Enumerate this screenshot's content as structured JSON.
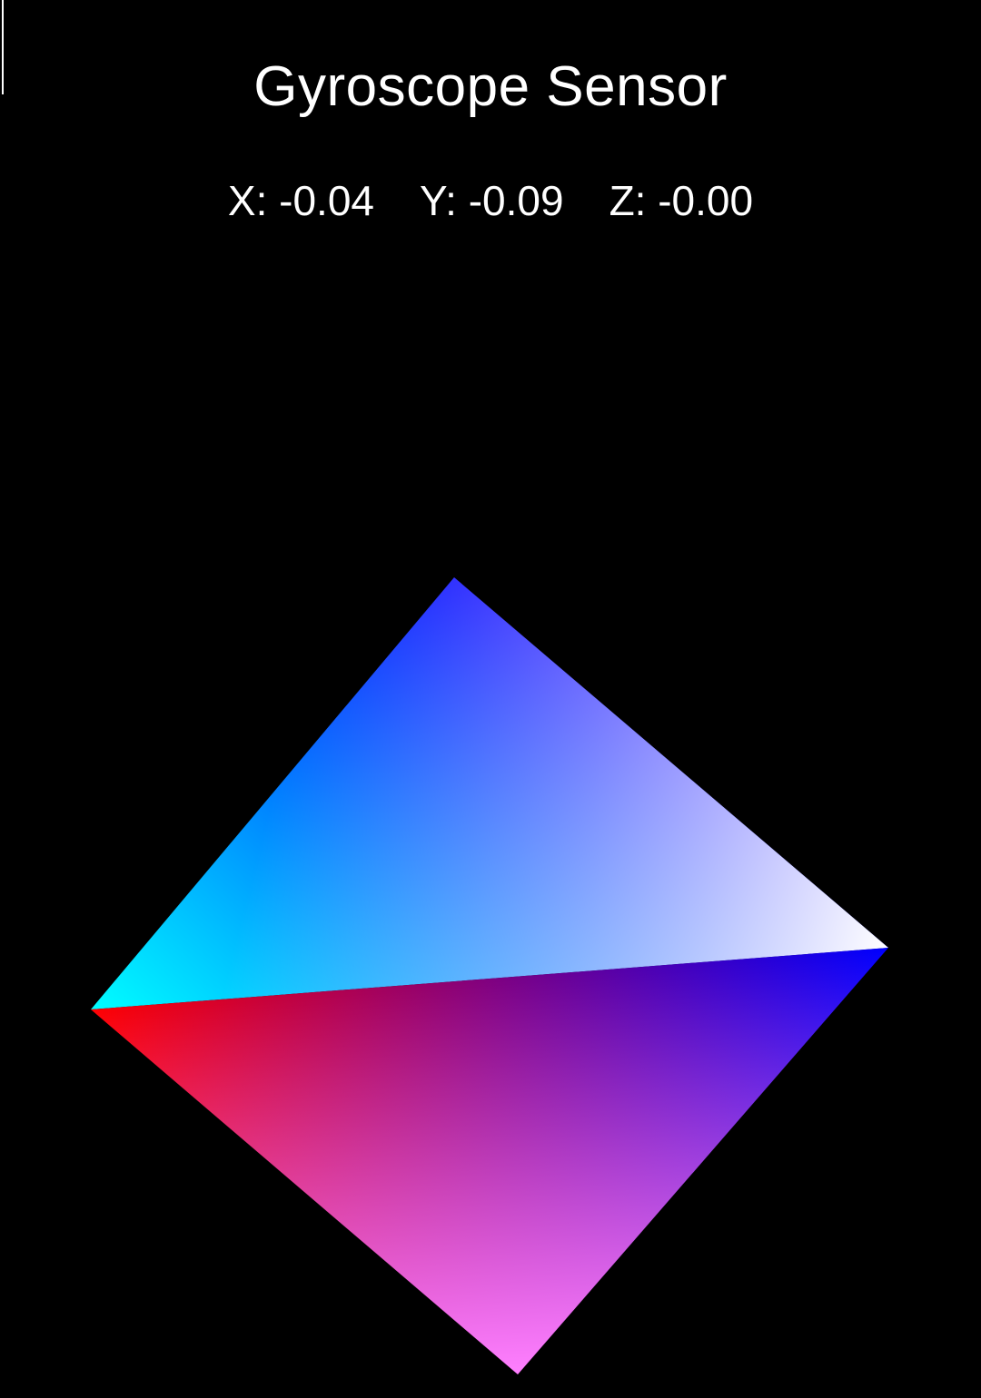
{
  "app": {
    "title": "Gyroscope Sensor"
  },
  "readouts": {
    "x": "X: -0.04",
    "y": "Y: -0.09",
    "z": "Z: -0.00"
  },
  "colors": {
    "background": "#000000",
    "text": "#ffffff",
    "red": "#ff0000",
    "blue": "#0000ff",
    "cyan": "#00ffff",
    "white": "#ffffff",
    "magenta": "#ff80ff"
  }
}
